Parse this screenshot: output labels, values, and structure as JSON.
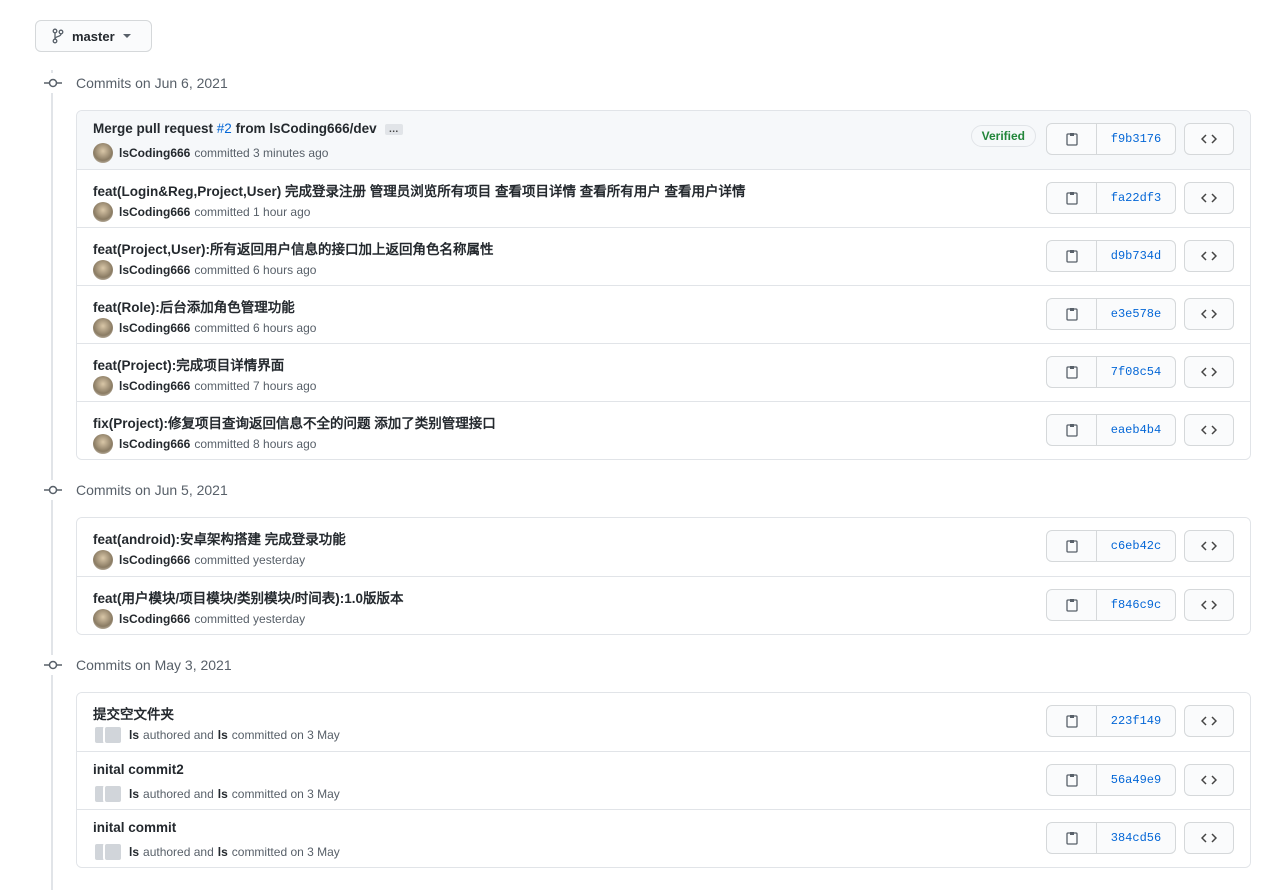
{
  "branch": {
    "name": "master"
  },
  "verified_label": "Verified",
  "groups": [
    {
      "title": "Commits on Jun 6, 2021",
      "commits": [
        {
          "pre": "Merge pull request ",
          "pr": "#2",
          "post": " from lsCoding666/dev",
          "ellipsis": "…",
          "author": "lsCoding666",
          "text": "committed 3 minutes ago",
          "sha": "f9b3176",
          "verified": true
        },
        {
          "pre": "feat(Login&Reg,Project,User) 完成登录注册 管理员浏览所有项目 查看项目详情 查看所有用户 查看用户详情",
          "author": "lsCoding666",
          "text": "committed 1 hour ago",
          "sha": "fa22df3"
        },
        {
          "pre": "feat(Project,User):所有返回用户信息的接口加上返回角色名称属性",
          "author": "lsCoding666",
          "text": "committed 6 hours ago",
          "sha": "d9b734d"
        },
        {
          "pre": "feat(Role):后台添加角色管理功能",
          "author": "lsCoding666",
          "text": "committed 6 hours ago",
          "sha": "e3e578e"
        },
        {
          "pre": "feat(Project):完成项目详情界面",
          "author": "lsCoding666",
          "text": "committed 7 hours ago",
          "sha": "7f08c54"
        },
        {
          "pre": "fix(Project):修复项目查询返回信息不全的问题 添加了类别管理接口",
          "author": "lsCoding666",
          "text": "committed 8 hours ago",
          "sha": "eaeb4b4"
        }
      ]
    },
    {
      "title": "Commits on Jun 5, 2021",
      "commits": [
        {
          "pre": "feat(android):安卓架构搭建 完成登录功能",
          "author": "lsCoding666",
          "text": "committed yesterday",
          "sha": "c6eb42c"
        },
        {
          "pre": "feat(用户模块/项目模块/类别模块/时间表):1.0版版本",
          "author": "lsCoding666",
          "text": "committed yesterday",
          "sha": "f846c9c"
        }
      ]
    },
    {
      "title": "Commits on May 3, 2021",
      "commits": [
        {
          "pre": "提交空文件夹",
          "author": "ls",
          "mid": "authored and",
          "committer": "ls",
          "text": "committed on 3 May",
          "sha": "223f149"
        },
        {
          "pre": "inital commit2",
          "author": "ls",
          "mid": "authored and",
          "committer": "ls",
          "text": "committed on 3 May",
          "sha": "56a49e9"
        },
        {
          "pre": "inital commit",
          "author": "ls",
          "mid": "authored and",
          "committer": "ls",
          "text": "committed on 3 May",
          "sha": "384cd56"
        }
      ]
    }
  ]
}
